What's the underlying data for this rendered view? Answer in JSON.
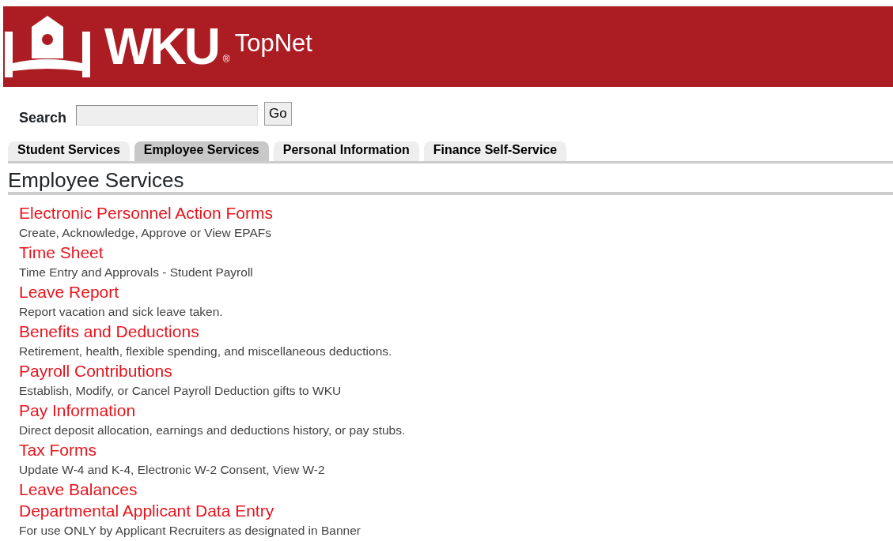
{
  "header": {
    "logo": "WKU",
    "registered": "®",
    "app_name": "TopNet"
  },
  "search": {
    "label": "Search",
    "button": "Go"
  },
  "tabs": [
    {
      "label": "Student Services",
      "selected": false
    },
    {
      "label": "Employee Services",
      "selected": true
    },
    {
      "label": "Personal Information",
      "selected": false
    },
    {
      "label": "Finance Self-Service",
      "selected": false
    }
  ],
  "page_title": "Employee Services",
  "menu": [
    {
      "title": "Electronic Personnel Action Forms",
      "description": "Create, Acknowledge, Approve or View EPAFs"
    },
    {
      "title": "Time Sheet",
      "description": "Time Entry and Approvals - Student Payroll"
    },
    {
      "title": "Leave Report",
      "description": "Report vacation and sick leave taken."
    },
    {
      "title": "Benefits and Deductions",
      "description": "Retirement, health, flexible spending, and miscellaneous deductions."
    },
    {
      "title": "Payroll Contributions",
      "description": "Establish, Modify, or Cancel Payroll Deduction gifts to WKU"
    },
    {
      "title": "Pay Information",
      "description": "Direct deposit allocation, earnings and deductions history, or pay stubs."
    },
    {
      "title": "Tax Forms",
      "description": "Update W-4 and K-4, Electronic W-2 Consent, View W-2"
    },
    {
      "title": "Leave Balances"
    },
    {
      "title": "Departmental Applicant Data Entry",
      "description": "For use ONLY by Applicant Recruiters as designated in Banner"
    }
  ]
}
